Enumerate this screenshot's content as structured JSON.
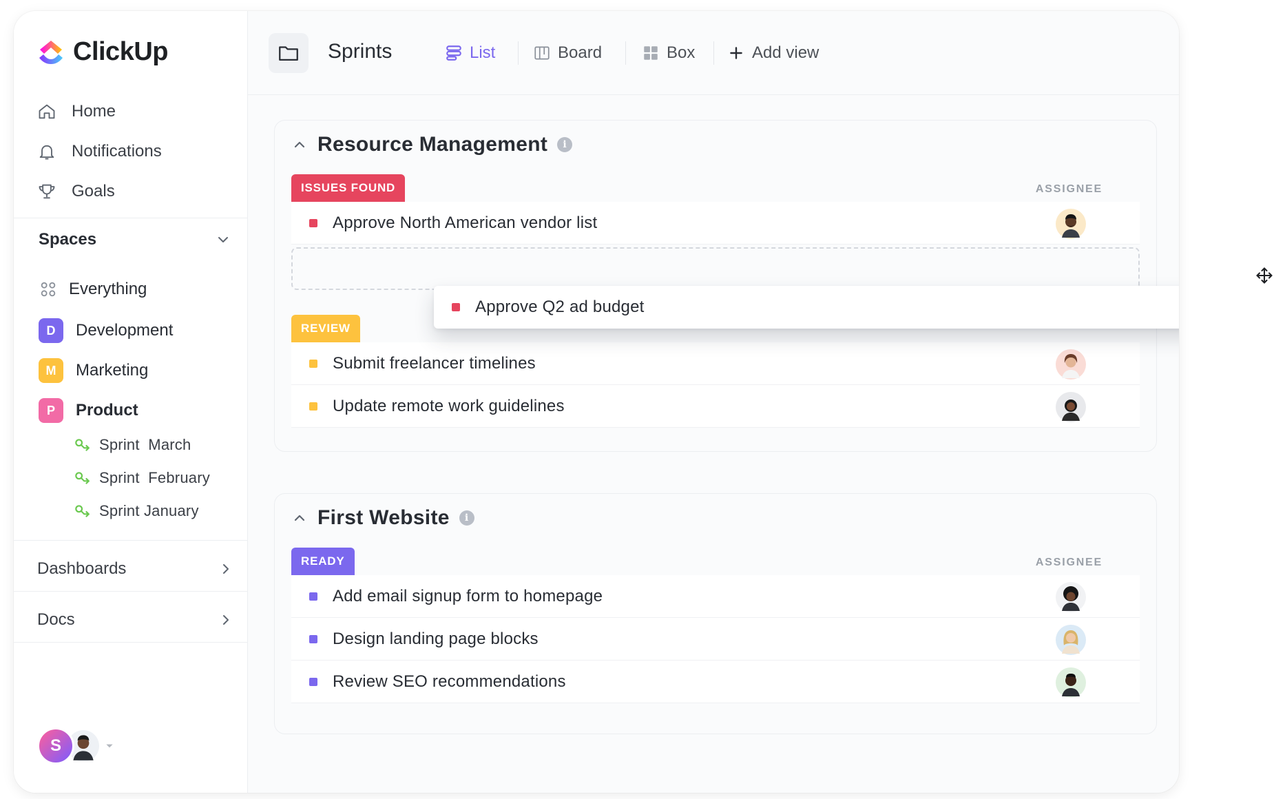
{
  "brand": {
    "name": "ClickUp"
  },
  "nav": [
    {
      "label": "Home",
      "icon": "home-icon"
    },
    {
      "label": "Notifications",
      "icon": "bell-icon"
    },
    {
      "label": "Goals",
      "icon": "trophy-icon"
    }
  ],
  "spaces": {
    "title": "Spaces",
    "everything": "Everything",
    "items": [
      {
        "letter": "D",
        "label": "Development",
        "color": "#7b68ee"
      },
      {
        "letter": "M",
        "label": "Marketing",
        "color": "#fdc23e"
      },
      {
        "letter": "P",
        "label": "Product",
        "color": "#f26ba6"
      }
    ],
    "sprints": [
      "Sprint  March",
      "Sprint  February",
      "Sprint January"
    ],
    "sprint_color": "#6bc950"
  },
  "sections": [
    "Dashboards",
    "Docs"
  ],
  "user": {
    "initial": "S"
  },
  "header": {
    "title": "Sprints",
    "tabs": [
      {
        "label": "List",
        "icon": "list-icon",
        "active": true
      },
      {
        "label": "Board",
        "icon": "board-icon",
        "active": false
      },
      {
        "label": "Box",
        "icon": "box-icon",
        "active": false
      },
      {
        "label": "Add view",
        "icon": "plus-icon",
        "active": false
      }
    ],
    "accent": "#7b68ee"
  },
  "groups": [
    {
      "title": "Resource Management",
      "column": "ASSIGNEE",
      "statuses": [
        {
          "label": "ISSUES FOUND",
          "color": "#e6455e",
          "tasks": [
            "Approve North American vendor list"
          ]
        },
        {
          "label": "REVIEW",
          "color": "#fdc23e",
          "tasks": [
            "Submit freelancer timelines",
            "Update remote work guidelines"
          ]
        }
      ]
    },
    {
      "title": "First Website",
      "column": "ASSIGNEE",
      "statuses": [
        {
          "label": "READY",
          "color": "#7b68ee",
          "tasks": [
            "Add email signup form to homepage",
            "Design landing page blocks",
            "Review SEO recommendations"
          ]
        }
      ]
    }
  ],
  "dragging": {
    "task": "Approve Q2 ad budget",
    "color": "#e6455e"
  }
}
